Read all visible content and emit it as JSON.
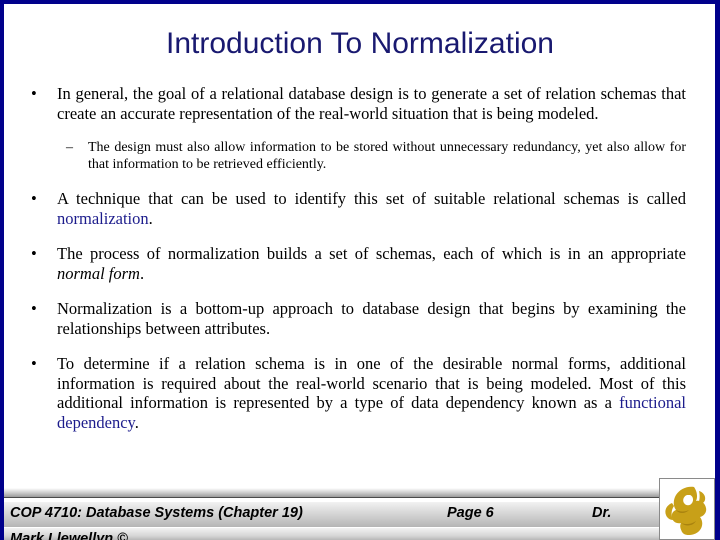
{
  "slide": {
    "title": "Introduction To Normalization",
    "accent_color": "#191970",
    "keyword_color": "#1c1c8c",
    "background": "#ffffff"
  },
  "content": {
    "bullets": [
      {
        "marker": "•",
        "level": 1,
        "text": "In general, the goal of a relational database design is to generate a set of relation schemas that create an accurate representation of the real-world situation that is being modeled."
      },
      {
        "marker": "–",
        "level": 2,
        "text": "The design must also allow information to be stored without unnecessary redundancy, yet also allow for that information to be retrieved efficiently."
      },
      {
        "marker": "•",
        "level": 1,
        "text_before": "A technique that can be used to identify this set of suitable relational schemas is called ",
        "keyword": "normalization",
        "keyword_style": "blue",
        "text_after": "."
      },
      {
        "marker": "•",
        "level": 1,
        "text_before": "The process of normalization builds a set of schemas, each of which is in an appropriate ",
        "keyword": "normal form",
        "keyword_style": "italic",
        "text_after": "."
      },
      {
        "marker": "•",
        "level": 1,
        "text": "Normalization is a bottom-up approach to database design that begins by examining the relationships between attributes."
      },
      {
        "marker": "•",
        "level": 1,
        "text_before": "To determine if a relation schema is in one of the desirable normal forms, additional information is required about the real-world scenario that is being modeled.  Most of this additional information is represented by a type of data dependency known as a ",
        "keyword": "functional dependency",
        "keyword_style": "blue",
        "text_after": "."
      }
    ]
  },
  "footer": {
    "course": "COP 4710: Database Systems  (Chapter 19)",
    "page": "Page 6",
    "presenter_prefix": "Dr.",
    "author": "Mark Llewellyn ©",
    "logo_name": "ucf-pegasus-logo",
    "logo_color": "#c8a018"
  }
}
